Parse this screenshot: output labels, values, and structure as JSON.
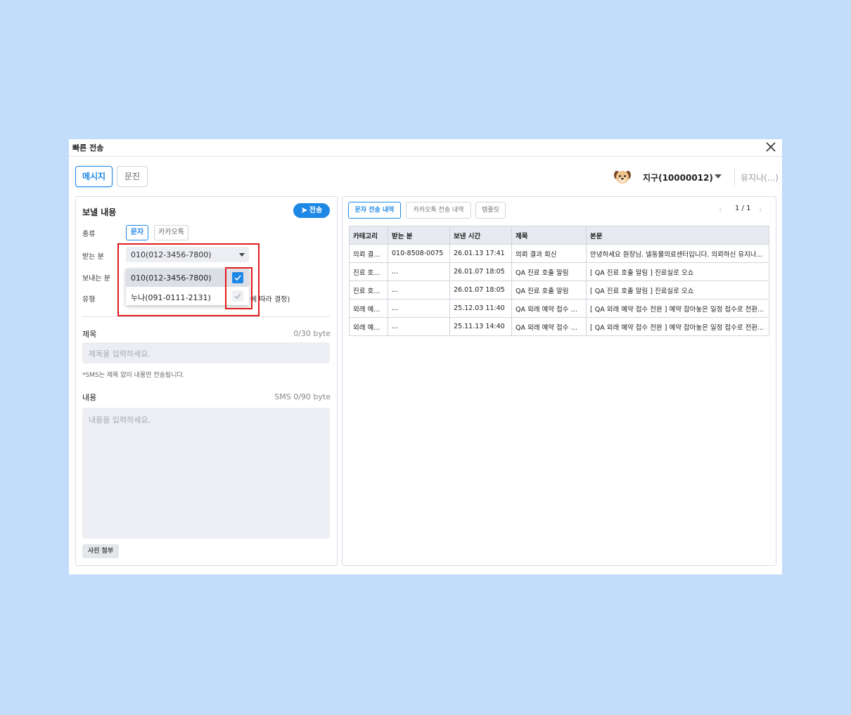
{
  "window": {
    "title": "빠른 전송"
  },
  "tabs": [
    {
      "label": "메시지",
      "active": true
    },
    {
      "label": "문진",
      "active": false
    }
  ],
  "user": {
    "name": "지구(10000012)",
    "other": "유지나(...)",
    "avatar_icon": "dog-face-icon"
  },
  "compose": {
    "title": "보낼 내용",
    "send_label": "전송",
    "type_label": "종류",
    "type_options": [
      {
        "label": "문자",
        "active": true
      },
      {
        "label": "카카오톡",
        "active": false
      }
    ],
    "recipient_label": "받는 분",
    "recipient_value": "010(012-3456-7800)",
    "sender_label": "보내는 분",
    "kind_label": "유형",
    "kind_suffix": "에 따라 결정)",
    "dropdown_options": [
      {
        "label": "010(012-3456-7800)",
        "checked": true
      },
      {
        "label": "누나(091-0111-2131)",
        "checked": false
      }
    ],
    "subject_label": "제목",
    "subject_counter": "0/30 byte",
    "subject_placeholder": "제목을 입력하세요.",
    "sms_hint": "*SMS는 제목 없이 내용만 전송됩니다.",
    "body_label": "내용",
    "body_counter": "SMS 0/90 byte",
    "body_placeholder": "내용을 입력하세요.",
    "attach_label": "사진 첨부"
  },
  "history": {
    "tabs": [
      {
        "label": "문자 전송 내역",
        "active": true
      },
      {
        "label": "카카오톡 전송 내역",
        "active": false
      },
      {
        "label": "템플릿",
        "active": false
      }
    ],
    "page": "1 / 1",
    "columns": [
      "카테고리",
      "받는 분",
      "보낸 시간",
      "제목",
      "본문"
    ],
    "rows": [
      [
        "의뢰 결과 회신",
        "010-8508-0075",
        "26.01.13 17:41",
        "의뢰 결과 회신",
        "안녕하세요 원장님. 넬동물의료센터입니다. 의뢰하신 유지나..."
      ],
      [
        "진료 호출 알림",
        "...",
        "26.01.07 18:05",
        "QA 진료 호출 알림",
        "[ QA 진료 호출 알림 ] 진료실로 오쇼"
      ],
      [
        "진료 호출 알림",
        "...",
        "26.01.07 18:05",
        "QA 진료 호출 알림",
        "[ QA 진료 호출 알림 ] 진료실로 오쇼"
      ],
      [
        "외래 예약 접수",
        "...",
        "25.12.03 11:40",
        "QA 외래 예약 접수 전완",
        "[ QA 외래 예약 접수 전완 ] 예약 잡아놓은 일정 접수로 전환..."
      ],
      [
        "외래 예약 접수",
        "...",
        "25.11.13 14:40",
        "QA 외래 예약 접수 전완",
        "[ QA 외래 예약 접수 전완 ] 예약 잡아놓은 일정 접수로 전환..."
      ]
    ]
  },
  "colors": {
    "accent": "#1e88e5",
    "highlight": "#e01c1c",
    "background": "#c2dcfa"
  }
}
